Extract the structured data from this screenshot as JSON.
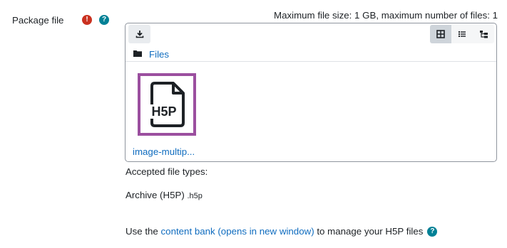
{
  "field": {
    "label": "Package file",
    "required_symbol": "!",
    "help_symbol": "?"
  },
  "filemanager": {
    "max_info": "Maximum file size: 1 GB, maximum number of files: 1",
    "download_icon": "download-icon",
    "view_icons": [
      "grid-icon",
      "list-icon",
      "tree-icon"
    ],
    "breadcrumb": "Files",
    "file": {
      "name": "image-multip...",
      "icon_text": "H5P"
    }
  },
  "accepted": {
    "heading": "Accepted file types:",
    "type_name": "Archive (H5P)",
    "type_ext": ".h5p"
  },
  "bank": {
    "prefix": "Use the ",
    "link": "content bank (opens in new window)",
    "suffix": " to manage your H5P files",
    "help_symbol": "?"
  },
  "colors": {
    "link": "#0f6cbf",
    "required": "#ca3120",
    "help": "#008196",
    "selection": "#9b4f9f"
  }
}
